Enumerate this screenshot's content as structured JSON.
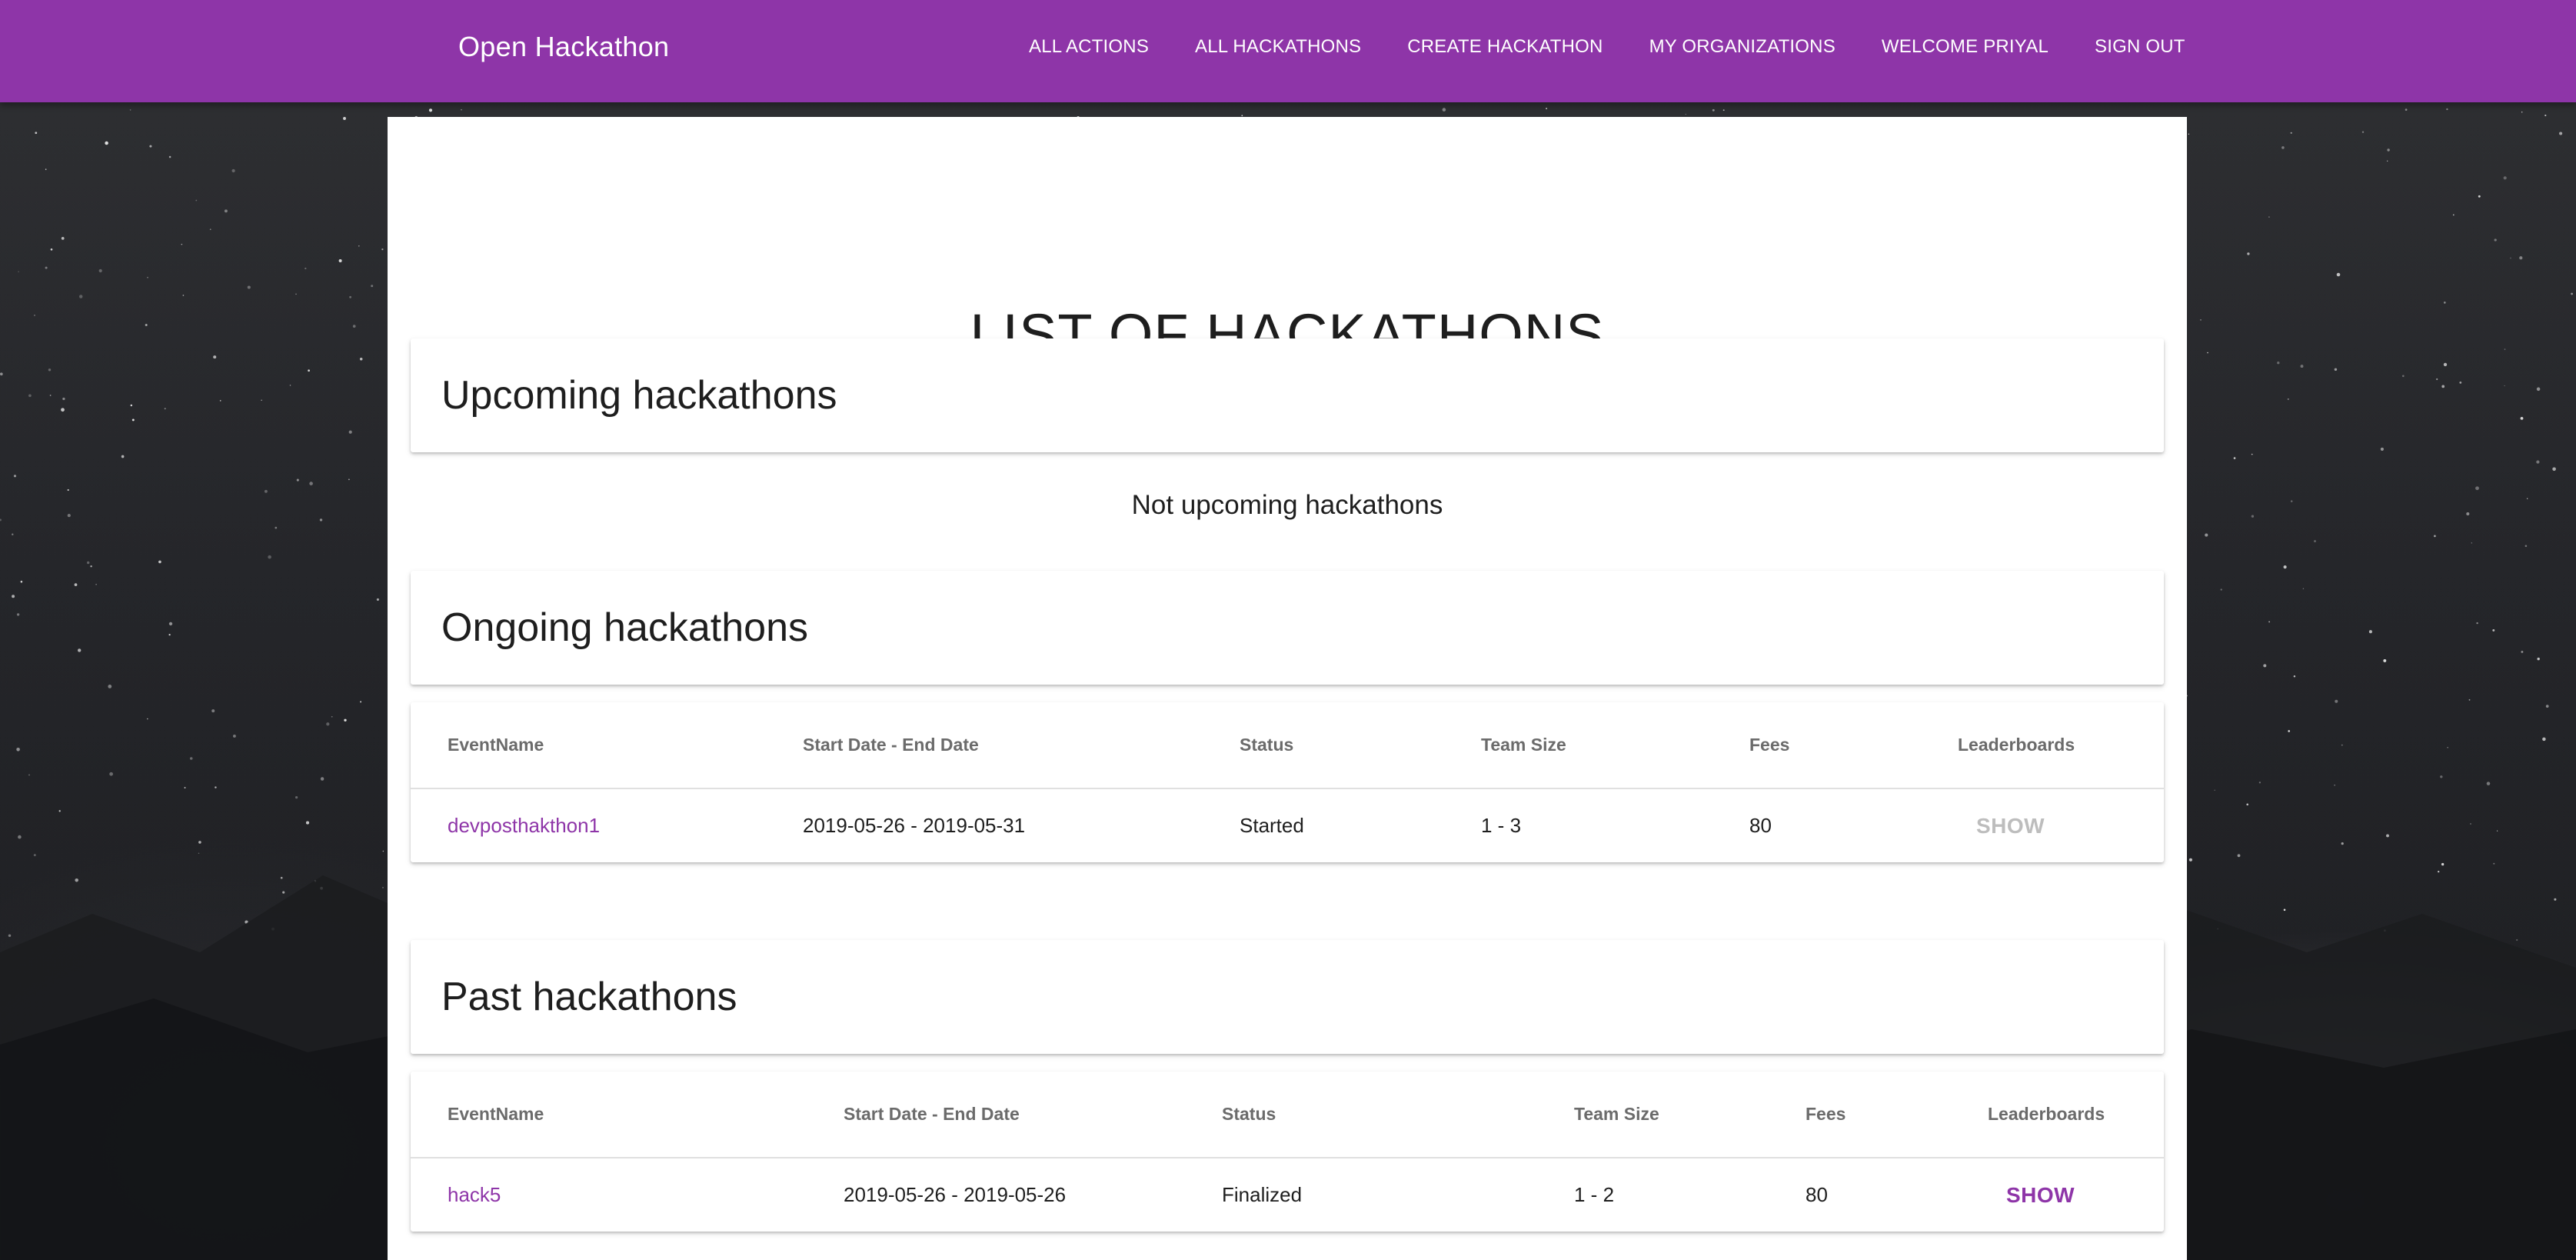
{
  "navbar": {
    "brand": "Open Hackathon",
    "links": [
      "All Actions",
      "All Hackathons",
      "Create Hackathon",
      "My Organizations",
      "Welcome Priyal",
      "Sign Out"
    ]
  },
  "page_title": "LIST OF HACKATHONS",
  "upcoming": {
    "title": "Upcoming hackathons",
    "empty_message": "Not upcoming hackathons"
  },
  "ongoing": {
    "title": "Ongoing hackathons",
    "columns": [
      "EventName",
      "Start Date - End Date",
      "Status",
      "Team Size",
      "Fees",
      "Leaderboards"
    ],
    "rows": [
      {
        "event": "devposthakthon1",
        "dates": "2019-05-26 - 2019-05-31",
        "status": "Started",
        "team_size": "1 - 3",
        "fees": "80",
        "leaderboard": "SHOW"
      }
    ]
  },
  "past": {
    "title": "Past hackathons",
    "columns": [
      "EventName",
      "Start Date - End Date",
      "Status",
      "Team Size",
      "Fees",
      "Leaderboards"
    ],
    "rows": [
      {
        "event": "hack5",
        "dates": "2019-05-26 - 2019-05-26",
        "status": "Finalized",
        "team_size": "1 - 2",
        "fees": "80",
        "leaderboard": "SHOW"
      }
    ]
  },
  "colors": {
    "brand": "#8e35a8",
    "disabled": "#bdbdbd"
  }
}
